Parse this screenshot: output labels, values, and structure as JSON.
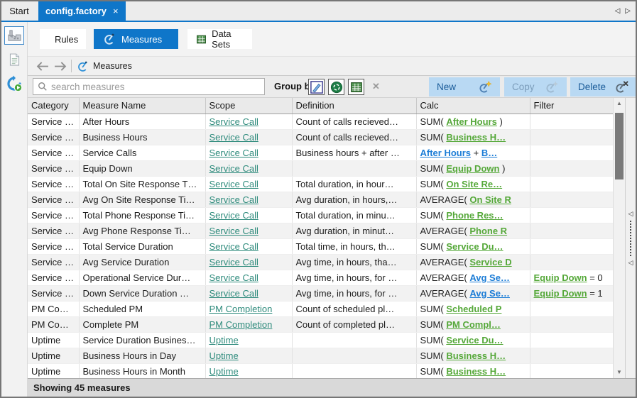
{
  "tabs": {
    "start": "Start",
    "active": "config.factory"
  },
  "icons": {
    "tab_close": "×",
    "tab_scroll_left": "◁",
    "tab_scroll_right": "▷",
    "clear_group_by": "✕",
    "scroll_up": "▲",
    "scroll_down": "▼",
    "splitter_collapse_top": "◁",
    "splitter_collapse_bottom": "◁"
  },
  "view_switcher": {
    "rules": "Rules",
    "measures": "Measures",
    "data_sets": "Data Sets"
  },
  "nav": {
    "breadcrumb": "Measures"
  },
  "actions": {
    "group_by_label": "Group by:",
    "new_label": "New",
    "copy_label": "Copy",
    "delete_label": "Delete"
  },
  "search": {
    "placeholder": "search measures"
  },
  "status": {
    "text": "Showing 45 measures"
  },
  "colors": {
    "accent_blue": "#0f76c9",
    "button_blue_bg": "#b9d9f3",
    "button_blue_text": "#1b5c99",
    "link_teal": "#2e8b7c",
    "link_green": "#55a839",
    "link_blue": "#1b7cd6",
    "row_alt": "#f2f2f2"
  },
  "table": {
    "columns": [
      "Category",
      "Measure Name",
      "Scope",
      "Definition",
      "Calc",
      "Filter"
    ],
    "rows": [
      {
        "category": "Service …",
        "name": "After Hours",
        "scope": "Service Call",
        "definition": "Count of calls recieved…",
        "calc": [
          {
            "t": "text",
            "v": "SUM( "
          },
          {
            "t": "green",
            "v": "After Hours"
          },
          {
            "t": "text",
            "v": " )"
          }
        ],
        "filter": []
      },
      {
        "category": "Service …",
        "name": "Business Hours",
        "scope": "Service Call",
        "definition": "Count of calls recieved…",
        "calc": [
          {
            "t": "text",
            "v": "SUM( "
          },
          {
            "t": "green",
            "v": "Business H…"
          }
        ],
        "filter": []
      },
      {
        "category": "Service …",
        "name": "Service Calls",
        "scope": "Service Call",
        "definition": "Business hours + after …",
        "calc": [
          {
            "t": "blue",
            "v": "After Hours"
          },
          {
            "t": "text",
            "v": " + "
          },
          {
            "t": "blue",
            "v": "B…"
          }
        ],
        "filter": []
      },
      {
        "category": "Service …",
        "name": "Equip Down",
        "scope": "Service Call",
        "definition": "",
        "calc": [
          {
            "t": "text",
            "v": "SUM( "
          },
          {
            "t": "green",
            "v": "Equip Down"
          },
          {
            "t": "text",
            "v": " )"
          }
        ],
        "filter": []
      },
      {
        "category": "Service …",
        "name": "Total On Site Response T…",
        "scope": "Service Call",
        "definition": "Total duration, in hour…",
        "calc": [
          {
            "t": "text",
            "v": "SUM( "
          },
          {
            "t": "green",
            "v": "On Site Re…"
          }
        ],
        "filter": []
      },
      {
        "category": "Service …",
        "name": "Avg On Site Response Ti…",
        "scope": "Service Call",
        "definition": "Avg duration, in hours,…",
        "calc": [
          {
            "t": "text",
            "v": "AVERAGE( "
          },
          {
            "t": "green",
            "v": "On Site R"
          }
        ],
        "filter": []
      },
      {
        "category": "Service …",
        "name": "Total Phone Response Ti…",
        "scope": "Service Call",
        "definition": "Total duration, in minu…",
        "calc": [
          {
            "t": "text",
            "v": "SUM( "
          },
          {
            "t": "green",
            "v": "Phone Res…"
          }
        ],
        "filter": []
      },
      {
        "category": "Service …",
        "name": "Avg Phone Response Ti…",
        "scope": "Service Call",
        "definition": "Avg duration, in minut…",
        "calc": [
          {
            "t": "text",
            "v": "AVERAGE( "
          },
          {
            "t": "green",
            "v": "Phone R"
          }
        ],
        "filter": []
      },
      {
        "category": "Service …",
        "name": "Total Service Duration",
        "scope": "Service Call",
        "definition": "Total time, in hours, th…",
        "calc": [
          {
            "t": "text",
            "v": "SUM( "
          },
          {
            "t": "green",
            "v": "Service Du…"
          }
        ],
        "filter": []
      },
      {
        "category": "Service …",
        "name": "Avg Service Duration",
        "scope": "Service Call",
        "definition": "Avg time, in hours, tha…",
        "calc": [
          {
            "t": "text",
            "v": "AVERAGE( "
          },
          {
            "t": "green",
            "v": "Service D"
          }
        ],
        "filter": []
      },
      {
        "category": "Service …",
        "name": "Operational Service Dur…",
        "scope": "Service Call",
        "definition": "Avg time, in hours, for …",
        "calc": [
          {
            "t": "text",
            "v": "AVERAGE( "
          },
          {
            "t": "blue",
            "v": "Avg Se…"
          }
        ],
        "filter": [
          {
            "t": "green",
            "v": "Equip Down"
          },
          {
            "t": "text",
            "v": " = 0"
          }
        ]
      },
      {
        "category": "Service …",
        "name": "Down Service Duration …",
        "scope": "Service Call",
        "definition": "Avg time, in hours, for …",
        "calc": [
          {
            "t": "text",
            "v": "AVERAGE( "
          },
          {
            "t": "blue",
            "v": "Avg Se…"
          }
        ],
        "filter": [
          {
            "t": "green",
            "v": "Equip Down"
          },
          {
            "t": "text",
            "v": " = 1"
          }
        ]
      },
      {
        "category": "PM Co…",
        "name": "Scheduled PM",
        "scope": "PM Completion",
        "definition": "Count of scheduled pl…",
        "calc": [
          {
            "t": "text",
            "v": "SUM( "
          },
          {
            "t": "green",
            "v": "Scheduled P"
          }
        ],
        "filter": []
      },
      {
        "category": "PM Co…",
        "name": "Complete PM",
        "scope": "PM Completion",
        "definition": "Count of completed pl…",
        "calc": [
          {
            "t": "text",
            "v": "SUM( "
          },
          {
            "t": "green",
            "v": "PM Compl…"
          }
        ],
        "filter": []
      },
      {
        "category": "Uptime",
        "name": "Service Duration Busines…",
        "scope": "Uptime",
        "definition": "",
        "calc": [
          {
            "t": "text",
            "v": "SUM( "
          },
          {
            "t": "green",
            "v": "Service Du…"
          }
        ],
        "filter": []
      },
      {
        "category": "Uptime",
        "name": "Business Hours in Day",
        "scope": "Uptime",
        "definition": "",
        "calc": [
          {
            "t": "text",
            "v": "SUM( "
          },
          {
            "t": "green",
            "v": "Business H…"
          }
        ],
        "filter": []
      },
      {
        "category": "Uptime",
        "name": "Business Hours in Month",
        "scope": "Uptime",
        "definition": "",
        "calc": [
          {
            "t": "text",
            "v": "SUM( "
          },
          {
            "t": "green",
            "v": "Business H…"
          }
        ],
        "filter": []
      }
    ]
  }
}
